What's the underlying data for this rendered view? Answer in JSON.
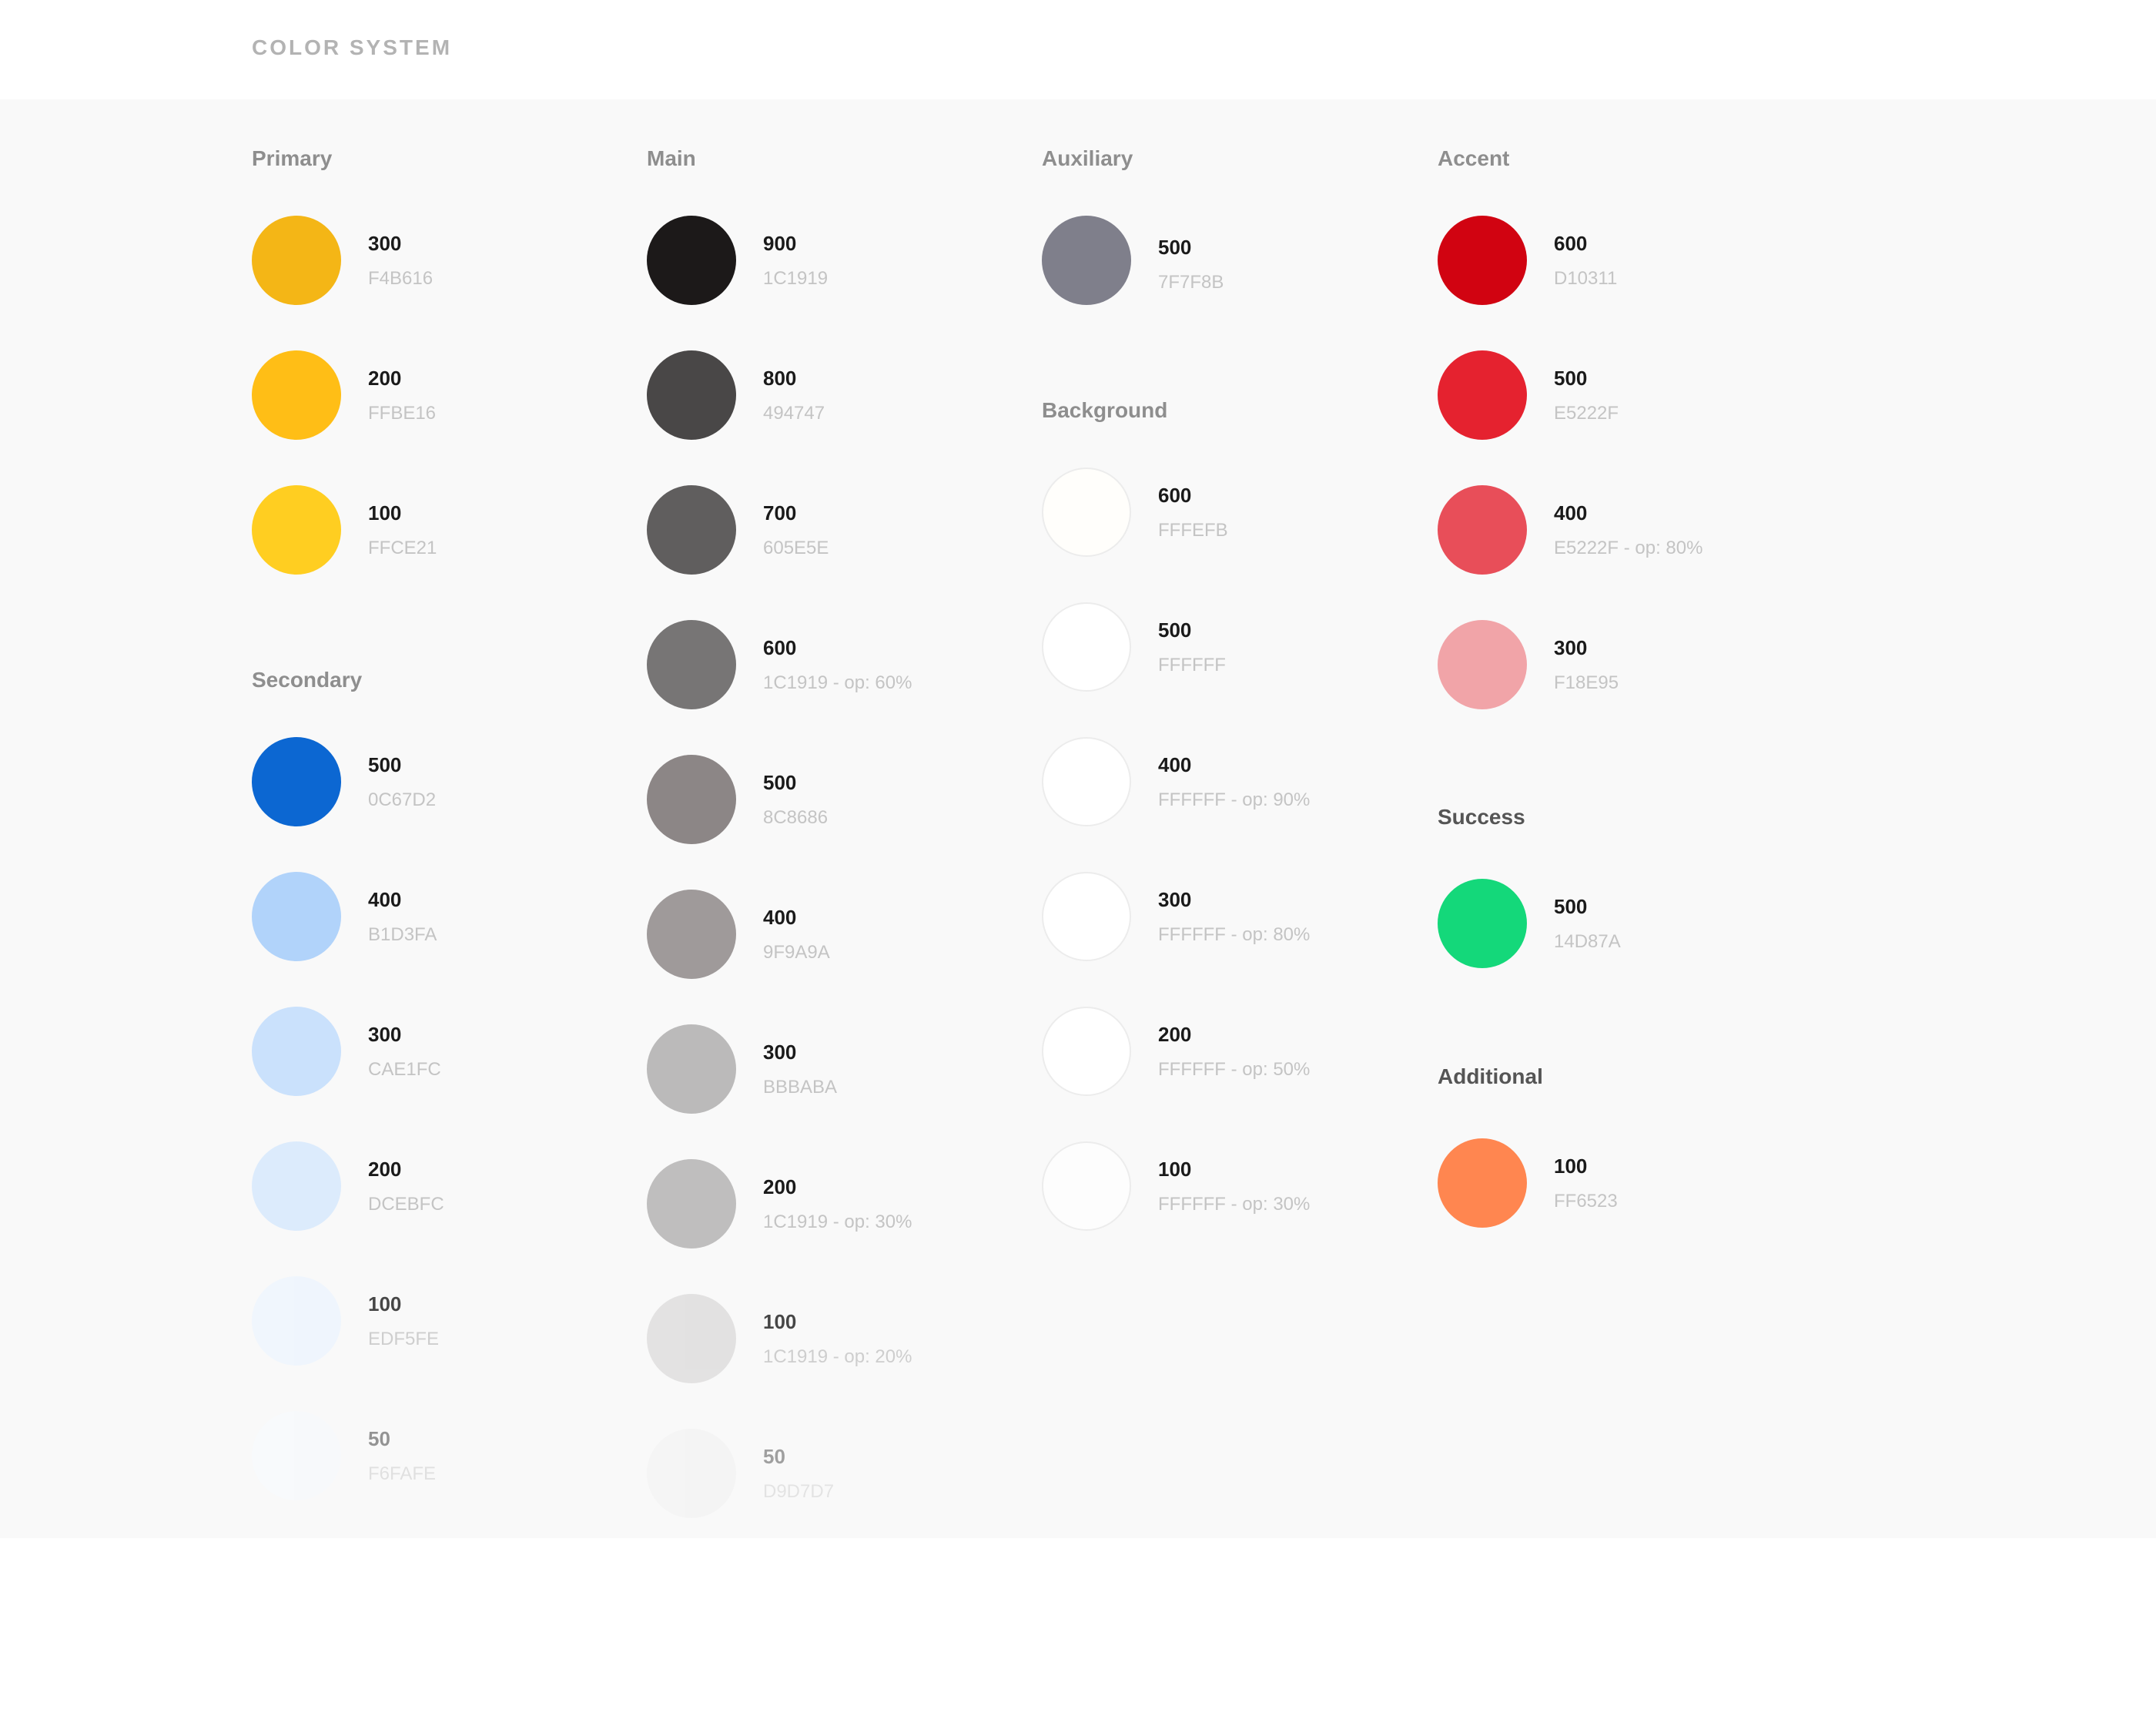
{
  "header": {
    "title": "COLOR SYSTEM"
  },
  "groups": {
    "primary": {
      "title": "Primary",
      "swatches": [
        {
          "shade": "300",
          "code": "F4B616",
          "color": "#F4B616"
        },
        {
          "shade": "200",
          "code": "FFBE16",
          "color": "#FFBE16"
        },
        {
          "shade": "100",
          "code": "FFCE21",
          "color": "#FFCE21"
        }
      ]
    },
    "secondary": {
      "title": "Secondary",
      "swatches": [
        {
          "shade": "500",
          "code": "0C67D2",
          "color": "#0C67D2"
        },
        {
          "shade": "400",
          "code": "B1D3FA",
          "color": "#B1D3FA"
        },
        {
          "shade": "300",
          "code": "CAE1FC",
          "color": "#CAE1FC"
        },
        {
          "shade": "200",
          "code": "DCEBFC",
          "color": "#DCEBFC"
        },
        {
          "shade": "100",
          "code": "EDF5FE",
          "color": "#EDF5FE"
        },
        {
          "shade": "50",
          "code": "F6FAFE",
          "color": "#F6FAFE"
        }
      ]
    },
    "main": {
      "title": "Main",
      "swatches": [
        {
          "shade": "900",
          "code": "1C1919",
          "color": "#1C1919"
        },
        {
          "shade": "800",
          "code": "494747",
          "color": "#494747"
        },
        {
          "shade": "700",
          "code": "605E5E",
          "color": "#605E5E"
        },
        {
          "shade": "600",
          "code": "1C1919 - op: 60%",
          "color": "#777575"
        },
        {
          "shade": "500",
          "code": "8C8686",
          "color": "#8C8686"
        },
        {
          "shade": "400",
          "code": "9F9A9A",
          "color": "#9F9A9A"
        },
        {
          "shade": "300",
          "code": "BBBABA",
          "color": "#BBBABA"
        },
        {
          "shade": "200",
          "code": "1C1919 - op: 30%",
          "color": "#BFBEBE"
        },
        {
          "shade": "100",
          "code": "1C1919 - op: 20%",
          "color": "#DDDCDC"
        },
        {
          "shade": "50",
          "code": "D9D7D7",
          "color": "#EFEFEF"
        }
      ]
    },
    "auxiliary": {
      "title": "Auxiliary",
      "swatches": [
        {
          "shade": "500",
          "code": "7F7F8B",
          "color": "#7F7F8B"
        }
      ]
    },
    "background": {
      "title": "Background",
      "swatches": [
        {
          "shade": "600",
          "code": "FFFEFB",
          "color": "#FFFEFB"
        },
        {
          "shade": "500",
          "code": "FFFFFF",
          "color": "#FFFFFF"
        },
        {
          "shade": "400",
          "code": "FFFFFF - op: 90%",
          "color": "#FFFFFF"
        },
        {
          "shade": "300",
          "code": "FFFFFF - op: 80%",
          "color": "#FFFFFF"
        },
        {
          "shade": "200",
          "code": "FFFFFF - op: 50%",
          "color": "#FFFFFF"
        },
        {
          "shade": "100",
          "code": "FFFFFF - op: 30%",
          "color": "#FDFDFD"
        }
      ]
    },
    "accent": {
      "title": "Accent",
      "swatches": [
        {
          "shade": "600",
          "code": "D10311",
          "color": "#D10311"
        },
        {
          "shade": "500",
          "code": "E5222F",
          "color": "#E5222F"
        },
        {
          "shade": "400",
          "code": "E5222F - op: 80%",
          "color": "#E84E59"
        },
        {
          "shade": "300",
          "code": "F18E95",
          "color": "#F1A4A8"
        }
      ]
    },
    "success": {
      "title": "Success",
      "swatches": [
        {
          "shade": "500",
          "code": "14D87A",
          "color": "#14D87A"
        }
      ]
    },
    "additional": {
      "title": "Additional",
      "swatches": [
        {
          "shade": "100",
          "code": "FF6523",
          "color": "#FF8650"
        }
      ]
    }
  }
}
